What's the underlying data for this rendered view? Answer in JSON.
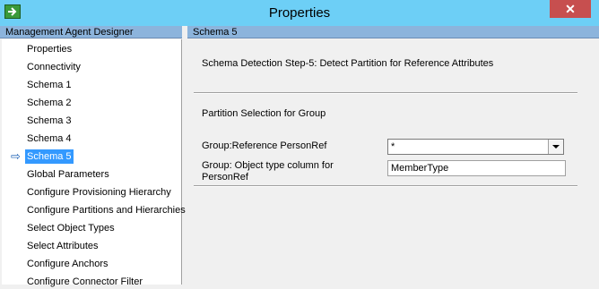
{
  "window": {
    "title": "Properties",
    "close_label": "✕",
    "icon": "app-icon"
  },
  "left_panel": {
    "header": "Management Agent Designer",
    "items": [
      {
        "label": "Properties"
      },
      {
        "label": "Connectivity"
      },
      {
        "label": "Schema 1"
      },
      {
        "label": "Schema 2"
      },
      {
        "label": "Schema 3"
      },
      {
        "label": "Schema 4"
      },
      {
        "label": "Schema 5",
        "selected": true
      },
      {
        "label": "Global Parameters"
      },
      {
        "label": "Configure Provisioning Hierarchy"
      },
      {
        "label": "Configure Partitions and Hierarchies"
      },
      {
        "label": "Select Object Types"
      },
      {
        "label": "Select Attributes"
      },
      {
        "label": "Configure Anchors"
      },
      {
        "label": "Configure Connector Filter"
      }
    ],
    "selected_marker": "⇨"
  },
  "right_panel": {
    "header": "Schema 5",
    "step_title": "Schema Detection Step-5: Detect Partition for Reference Attributes",
    "section_title": "Partition Selection for Group",
    "fields": [
      {
        "label": "Group:Reference PersonRef",
        "type": "select",
        "value": "*"
      },
      {
        "label_line1": "Group: Object type column for",
        "label_line2": "PersonRef",
        "type": "text",
        "value": "MemberType"
      }
    ]
  },
  "colors": {
    "title_bar": "#6dcff6",
    "header_bar": "#8cb4dc",
    "selection": "#3399ff",
    "close": "#c74f4f"
  }
}
